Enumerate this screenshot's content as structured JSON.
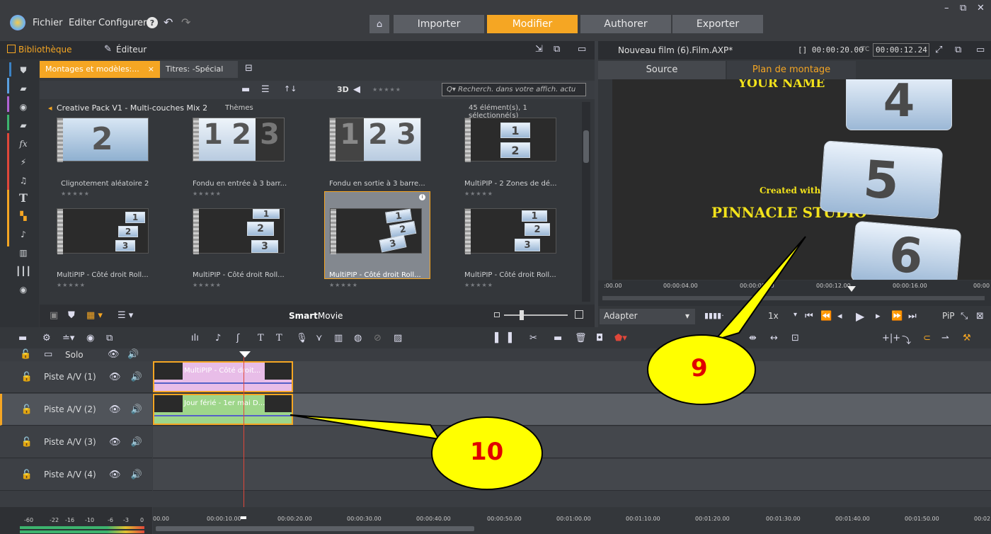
{
  "menu": {
    "fichier": "Fichier",
    "editer": "Editer",
    "configurer": "Configurer"
  },
  "nav": {
    "importer": "Importer",
    "modifier": "Modifier",
    "authorer": "Authorer",
    "exporter": "Exporter"
  },
  "library": {
    "tab_bibliotheque": "Bibliothèque",
    "tab_editeur": "Éditeur",
    "subtab_montages": "Montages et modèles:...",
    "subtab_titres": "Titres: -Spécial",
    "btn_3d": "3D",
    "search_placeholder": "Recherch. dans votre affich. actu",
    "collection": "Creative Pack V1 - Multi-couches Mix 2",
    "themes": "Thèmes",
    "count": "45 élément(s), 1 sélectionné(s)",
    "items": [
      {
        "title": "Clignotement aléatoire 2",
        "stars": "★★★★★"
      },
      {
        "title": "Fondu en entrée à 3 barr...",
        "stars": "★★★★★"
      },
      {
        "title": "Fondu en sortie à 3 barre...",
        "stars": "★★★★★"
      },
      {
        "title": "MultiPIP - 2 Zones de dé...",
        "stars": "★★★★★"
      },
      {
        "title": "MultiPIP - Côté droit Roll...",
        "stars": "★★★★★"
      },
      {
        "title": "MultiPIP - Côté droit Roll...",
        "stars": "★★★★★"
      },
      {
        "title": "MultiPIP - Côté droit Roll...",
        "stars": "★★★★★"
      },
      {
        "title": "MultiPIP - Côté droit Roll...",
        "stars": "★★★★★"
      }
    ],
    "smartmovie_a": "Smart",
    "smartmovie_b": "Movie"
  },
  "player": {
    "title": "Nouveau film (6).Film.AXP*",
    "duration": "[] 00:00:20.00",
    "tc_label": "TC",
    "tc_value": "00:00:12.24",
    "tab_source": "Source",
    "tab_plan": "Plan de montage",
    "text_yourname": "YOUR NAME",
    "text_created": "Created with",
    "text_pinnacle": "PINNACLE STUDIO",
    "ruler": [
      ":00.00",
      "00:00:04.00",
      "00:00:08.00",
      "00:00:12.00",
      "00:00:16.00",
      "00:00"
    ],
    "fit": "Adapter",
    "speed": "1x",
    "pip": "PiP"
  },
  "timeline": {
    "solo": "Solo",
    "tracks": [
      "Piste A/V (1)",
      "Piste A/V (2)",
      "Piste A/V (3)",
      "Piste A/V (4)"
    ],
    "clip1": "MultiPIP - Côté droit...",
    "clip2": "Jour férié - 1er mai D...",
    "meter": [
      "-60",
      "-22",
      "-16",
      "-10",
      "-6",
      "-3",
      "0"
    ],
    "ruler": [
      "00.00",
      "00:00:10.00",
      "00:00:20.00",
      "00:00:30.00",
      "00:00:40.00",
      "00:00:50.00",
      "00:01:00.00",
      "00:01:10.00",
      "00:01:20.00",
      "00:01:30.00",
      "00:01:40.00",
      "00:01:50.00",
      "00:02"
    ]
  },
  "callouts": {
    "c9": "9",
    "c10": "10"
  },
  "colors": {
    "accent": "#f5a623",
    "bg": "#3c3f44",
    "callout": "#ffff00",
    "callout_text": "#e00000"
  }
}
